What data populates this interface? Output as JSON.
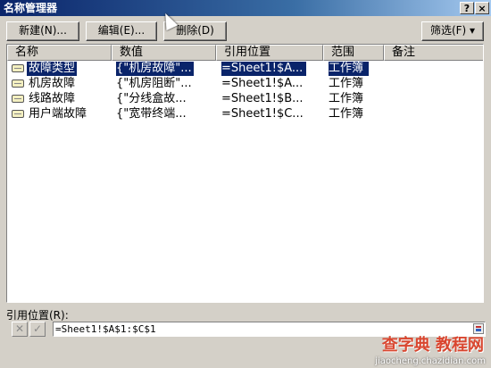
{
  "window": {
    "title": "名称管理器",
    "help_label": "?",
    "close_label": "×"
  },
  "toolbar": {
    "new_label": "新建(N)...",
    "edit_label": "编辑(E)...",
    "delete_label": "删除(D)",
    "filter_label": "筛选(F) ▾"
  },
  "list": {
    "columns": [
      "名称",
      "数值",
      "引用位置",
      "范围",
      "备注"
    ],
    "rows": [
      {
        "name": "故障类型",
        "value": "{\"机房故障\"...",
        "ref": "=Sheet1!$A...",
        "scope": "工作簿",
        "note": "",
        "selected": true
      },
      {
        "name": "机房故障",
        "value": "{\"机房阻断\"...",
        "ref": "=Sheet1!$A...",
        "scope": "工作簿",
        "note": "",
        "selected": false
      },
      {
        "name": "线路故障",
        "value": "{\"分线盒故...",
        "ref": "=Sheet1!$B...",
        "scope": "工作簿",
        "note": "",
        "selected": false
      },
      {
        "name": "用户端故障",
        "value": "{\"宽带终端...",
        "ref": "=Sheet1!$C...",
        "scope": "工作簿",
        "note": "",
        "selected": false
      }
    ]
  },
  "refers_to": {
    "label": "引用位置(R):",
    "cancel_symbol": "✕",
    "confirm_symbol": "✓",
    "value": "=Sheet1!$A$1:$C$1"
  },
  "watermark": {
    "text": "查字典 教程网",
    "url": "jiaocheng.chazidian.com"
  }
}
